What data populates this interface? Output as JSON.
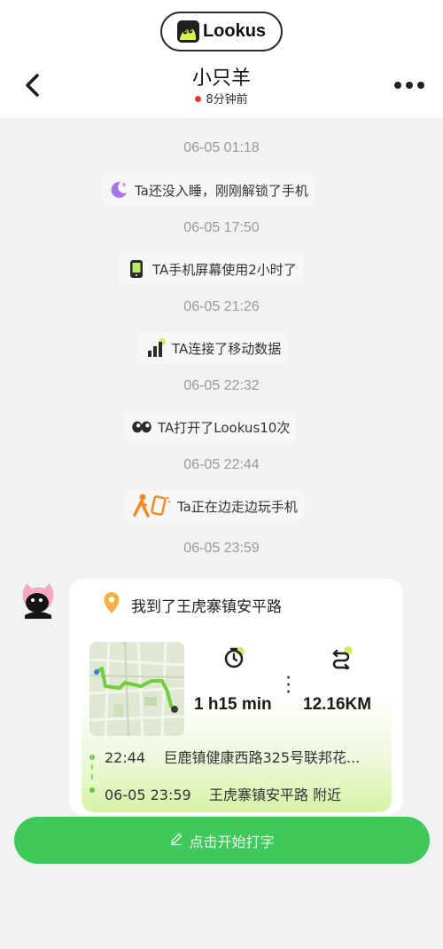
{
  "app": {
    "brand": "Lookus"
  },
  "header": {
    "title": "小只羊",
    "status": "8分钟前"
  },
  "feed": {
    "t1": "06-05 01:18",
    "e1": "Ta还没入睡，刚刚解锁了手机",
    "t2": "06-05 17:50",
    "e2": "TA手机屏幕使用2小时了",
    "t3": "06-05 21:26",
    "e3": "TA连接了移动数据",
    "t4": "06-05 22:32",
    "e4": "TA打开了Lookus10次",
    "t5": "06-05 22:44",
    "e5": "Ta正在边走边玩手机",
    "t6": "06-05 23:59"
  },
  "card": {
    "title": "我到了王虎寨镇安平路",
    "duration": "1 h15 min",
    "distance": "12.16KM",
    "start_time": "22:44",
    "start_place": "巨鹿镇健康西路325号联邦花...",
    "end_time": "06-05 23:59",
    "end_place": "王虎寨镇安平路 附近"
  },
  "composer": {
    "label": "点击开始打字"
  },
  "colors": {
    "accent": "#3ec95a",
    "lime": "#c8f06a",
    "status_dot": "#e53935"
  }
}
